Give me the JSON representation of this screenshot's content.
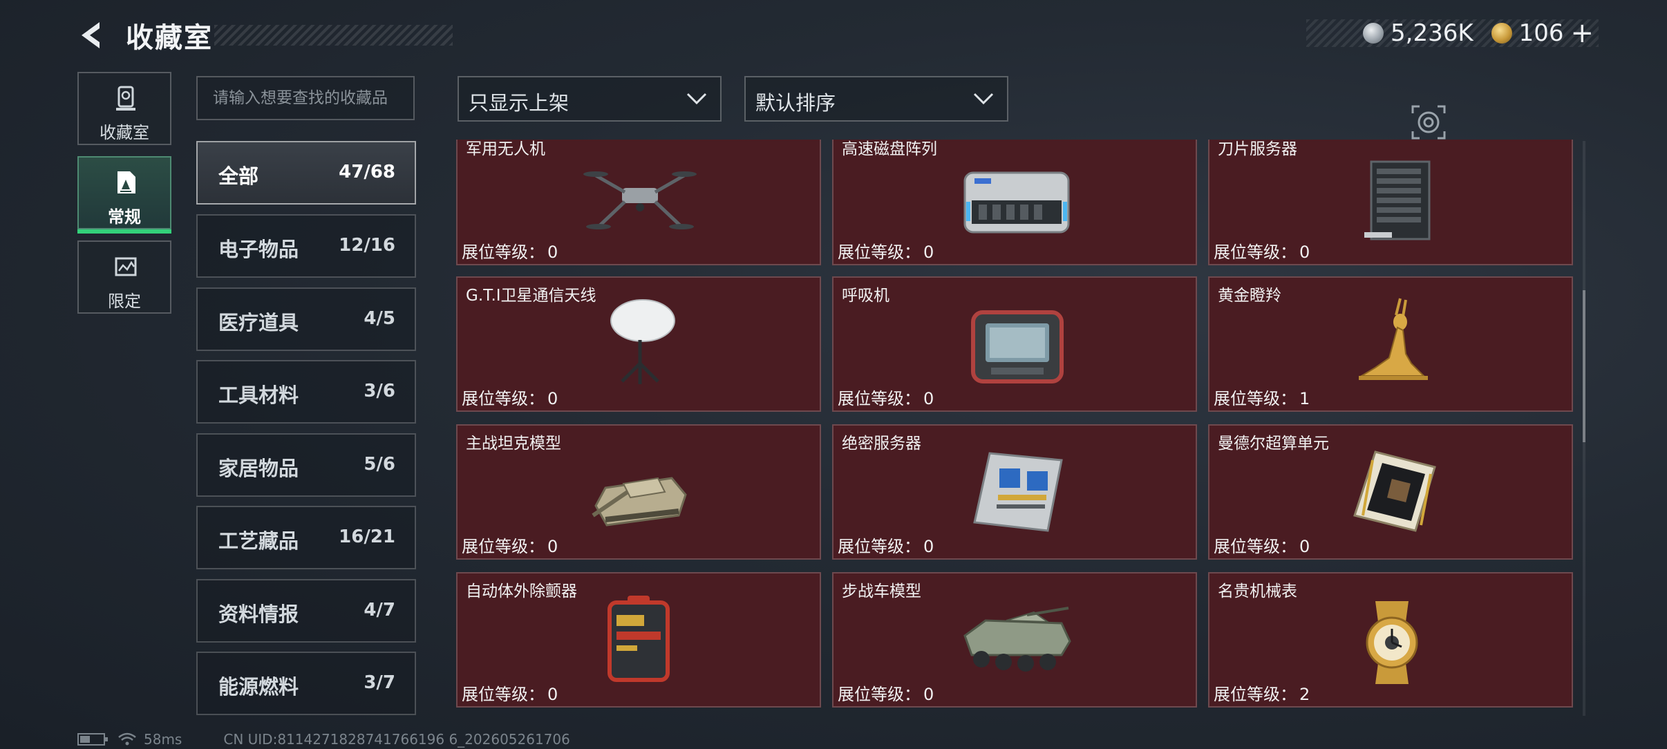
{
  "header": {
    "title": "收藏室"
  },
  "currency": {
    "silver": "5,236K",
    "gold": "106",
    "add_label": "+"
  },
  "side_tabs": [
    {
      "label": "收藏室",
      "icon": "trophy-icon"
    },
    {
      "label": "常规",
      "icon": "card-icon"
    },
    {
      "label": "限定",
      "icon": "limited-icon"
    }
  ],
  "search": {
    "placeholder": "请输入想要查找的收藏品"
  },
  "filters": {
    "shelf_filter": "只显示上架",
    "sort": "默认排序"
  },
  "categories": [
    {
      "label": "全部",
      "count": "47/68"
    },
    {
      "label": "电子物品",
      "count": "12/16"
    },
    {
      "label": "医疗道具",
      "count": "4/5"
    },
    {
      "label": "工具材料",
      "count": "3/6"
    },
    {
      "label": "家居物品",
      "count": "5/6"
    },
    {
      "label": "工艺藏品",
      "count": "16/21"
    },
    {
      "label": "资料情报",
      "count": "4/7"
    },
    {
      "label": "能源燃料",
      "count": "3/7"
    }
  ],
  "level_label": "展位等级：",
  "items": [
    {
      "name": "军用无人机",
      "level": "0",
      "icon": "drone-icon"
    },
    {
      "name": "高速磁盘阵列",
      "level": "0",
      "icon": "disk-array-icon"
    },
    {
      "name": "刀片服务器",
      "level": "0",
      "icon": "blade-server-icon"
    },
    {
      "name": "G.T.I卫星通信天线",
      "level": "0",
      "icon": "satellite-dish-icon"
    },
    {
      "name": "呼吸机",
      "level": "0",
      "icon": "ventilator-icon"
    },
    {
      "name": "黄金瞪羚",
      "level": "1",
      "icon": "gazelle-statue-icon"
    },
    {
      "name": "主战坦克模型",
      "level": "0",
      "icon": "tank-model-icon"
    },
    {
      "name": "绝密服务器",
      "level": "0",
      "icon": "server-board-icon"
    },
    {
      "name": "曼德尔超算单元",
      "level": "0",
      "icon": "supercomputer-icon"
    },
    {
      "name": "自动体外除颤器",
      "level": "0",
      "icon": "defibrillator-icon"
    },
    {
      "name": "步战车模型",
      "level": "0",
      "icon": "ifv-model-icon"
    },
    {
      "name": "名贵机械表",
      "level": "2",
      "icon": "watch-icon"
    }
  ],
  "footer": {
    "ping": "58ms",
    "uid": "CN UID:8114271828741766196 6_202605261706"
  }
}
